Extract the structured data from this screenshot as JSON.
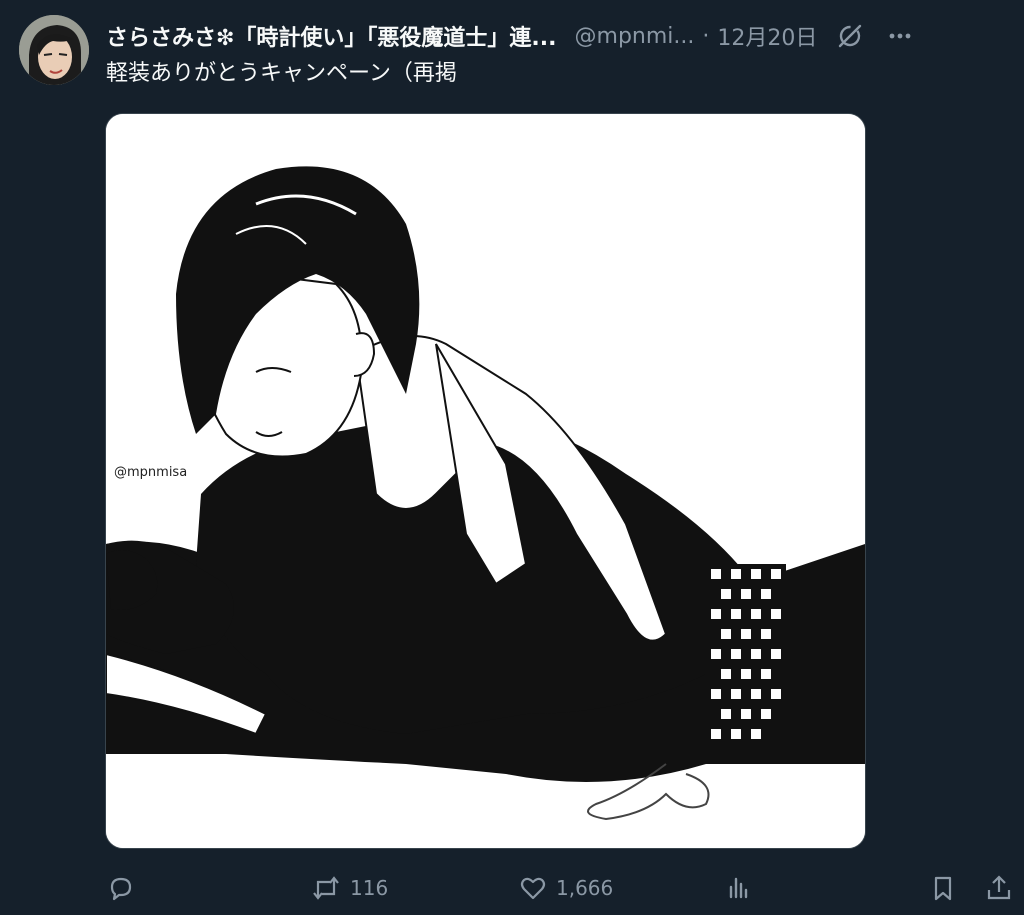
{
  "author": {
    "display_name": "さらさみさ❇︎「時計使い」「悪役魔道士」連...",
    "handle": "@mpnmi...",
    "separator": "·",
    "timestamp": "12月20日"
  },
  "tweet": {
    "text": "軽装ありがとうキャンペーン（再掲"
  },
  "media": {
    "signature": "@mpnmisa"
  },
  "actions": {
    "reply_count": "",
    "retweet_count": "116",
    "like_count": "1,666",
    "views_count": ""
  },
  "icons": {
    "grok": "grok-icon",
    "more": "more-icon",
    "reply": "reply-icon",
    "retweet": "retweet-icon",
    "like": "heart-icon",
    "views": "views-icon",
    "bookmark": "bookmark-icon",
    "share": "share-icon"
  },
  "colors": {
    "background": "#15202b",
    "text_primary": "#f7f9f9",
    "text_secondary": "#8b98a5",
    "border": "#38444d"
  }
}
